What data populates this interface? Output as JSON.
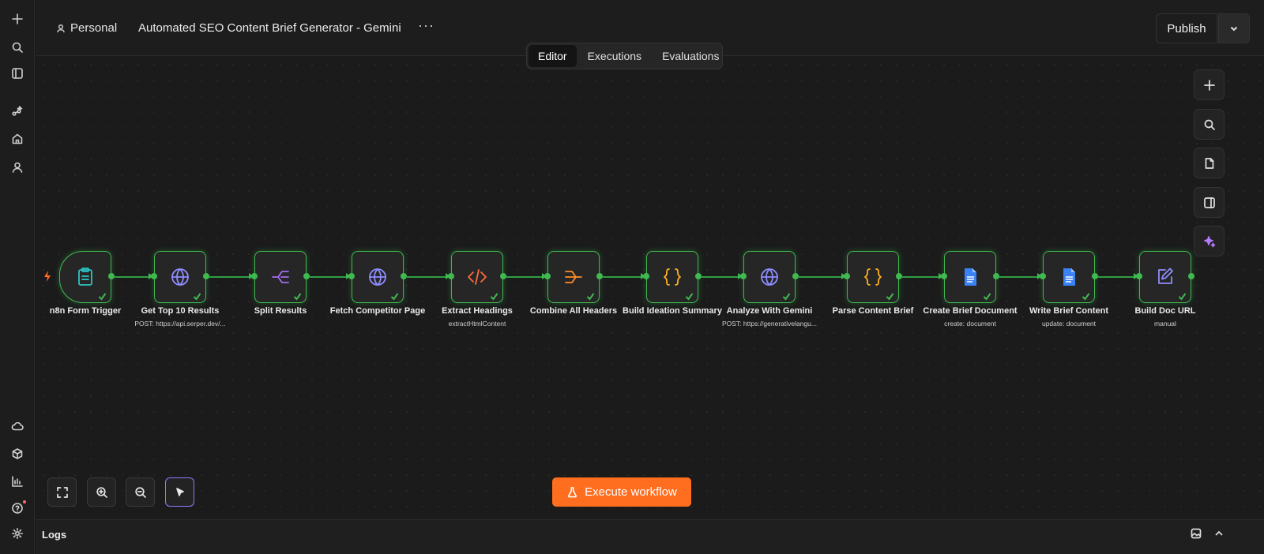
{
  "app": {
    "accent": "#ff6d1f",
    "success": "#3fb950"
  },
  "rail": {
    "top": [
      {
        "name": "plus-icon"
      },
      {
        "name": "search-icon"
      },
      {
        "name": "panel-icon"
      },
      {
        "name": "sparkle-nodes-icon"
      },
      {
        "name": "home-icon"
      },
      {
        "name": "user-icon"
      }
    ],
    "bottom": [
      {
        "name": "cloud-icon"
      },
      {
        "name": "package-icon"
      },
      {
        "name": "bar-chart-icon"
      },
      {
        "name": "help-icon"
      },
      {
        "name": "settings-icon"
      }
    ]
  },
  "header": {
    "project": "Personal",
    "title": "Automated SEO Content Brief Generator - Gemini",
    "more": "···",
    "publish_label": "Publish"
  },
  "tabs": [
    {
      "label": "Editor",
      "active": true
    },
    {
      "label": "Executions",
      "active": false
    },
    {
      "label": "Evaluations",
      "active": false
    }
  ],
  "nodes": [
    {
      "label": "n8n Form Trigger",
      "sub": "",
      "icon": "clipboard-icon",
      "color": "#2ec4c4"
    },
    {
      "label": "Get Top 10 Results",
      "sub": "POST: https://api.serper.dev/...",
      "icon": "globe-icon",
      "color": "#8e8cff"
    },
    {
      "label": "Split Results",
      "sub": "",
      "icon": "split-icon",
      "color": "#a56cf0"
    },
    {
      "label": "Fetch Competitor Page",
      "sub": "",
      "icon": "globe-icon",
      "color": "#8e8cff"
    },
    {
      "label": "Extract Headings",
      "sub": "extractHtmlContent",
      "icon": "code-icon",
      "color": "#ff6b3d"
    },
    {
      "label": "Combine All Headers",
      "sub": "",
      "icon": "merge-icon",
      "color": "#ff8c2a"
    },
    {
      "label": "Build Ideation Summary",
      "sub": "",
      "icon": "braces-icon",
      "color": "#ffb020"
    },
    {
      "label": "Analyze With Gemini",
      "sub": "POST: https://generativelangu...",
      "icon": "globe-icon",
      "color": "#8e8cff"
    },
    {
      "label": "Parse Content Brief",
      "sub": "",
      "icon": "braces-icon",
      "color": "#ffb020"
    },
    {
      "label": "Create Brief Document",
      "sub": "create: document",
      "icon": "google-docs-icon",
      "color": "#3b82f6"
    },
    {
      "label": "Write Brief Content",
      "sub": "update: document",
      "icon": "google-docs-icon",
      "color": "#3b82f6"
    },
    {
      "label": "Build Doc URL",
      "sub": "manual",
      "icon": "edit-icon",
      "color": "#8e8cff"
    }
  ],
  "execute_label": "Execute workflow",
  "logs": {
    "label": "Logs"
  }
}
